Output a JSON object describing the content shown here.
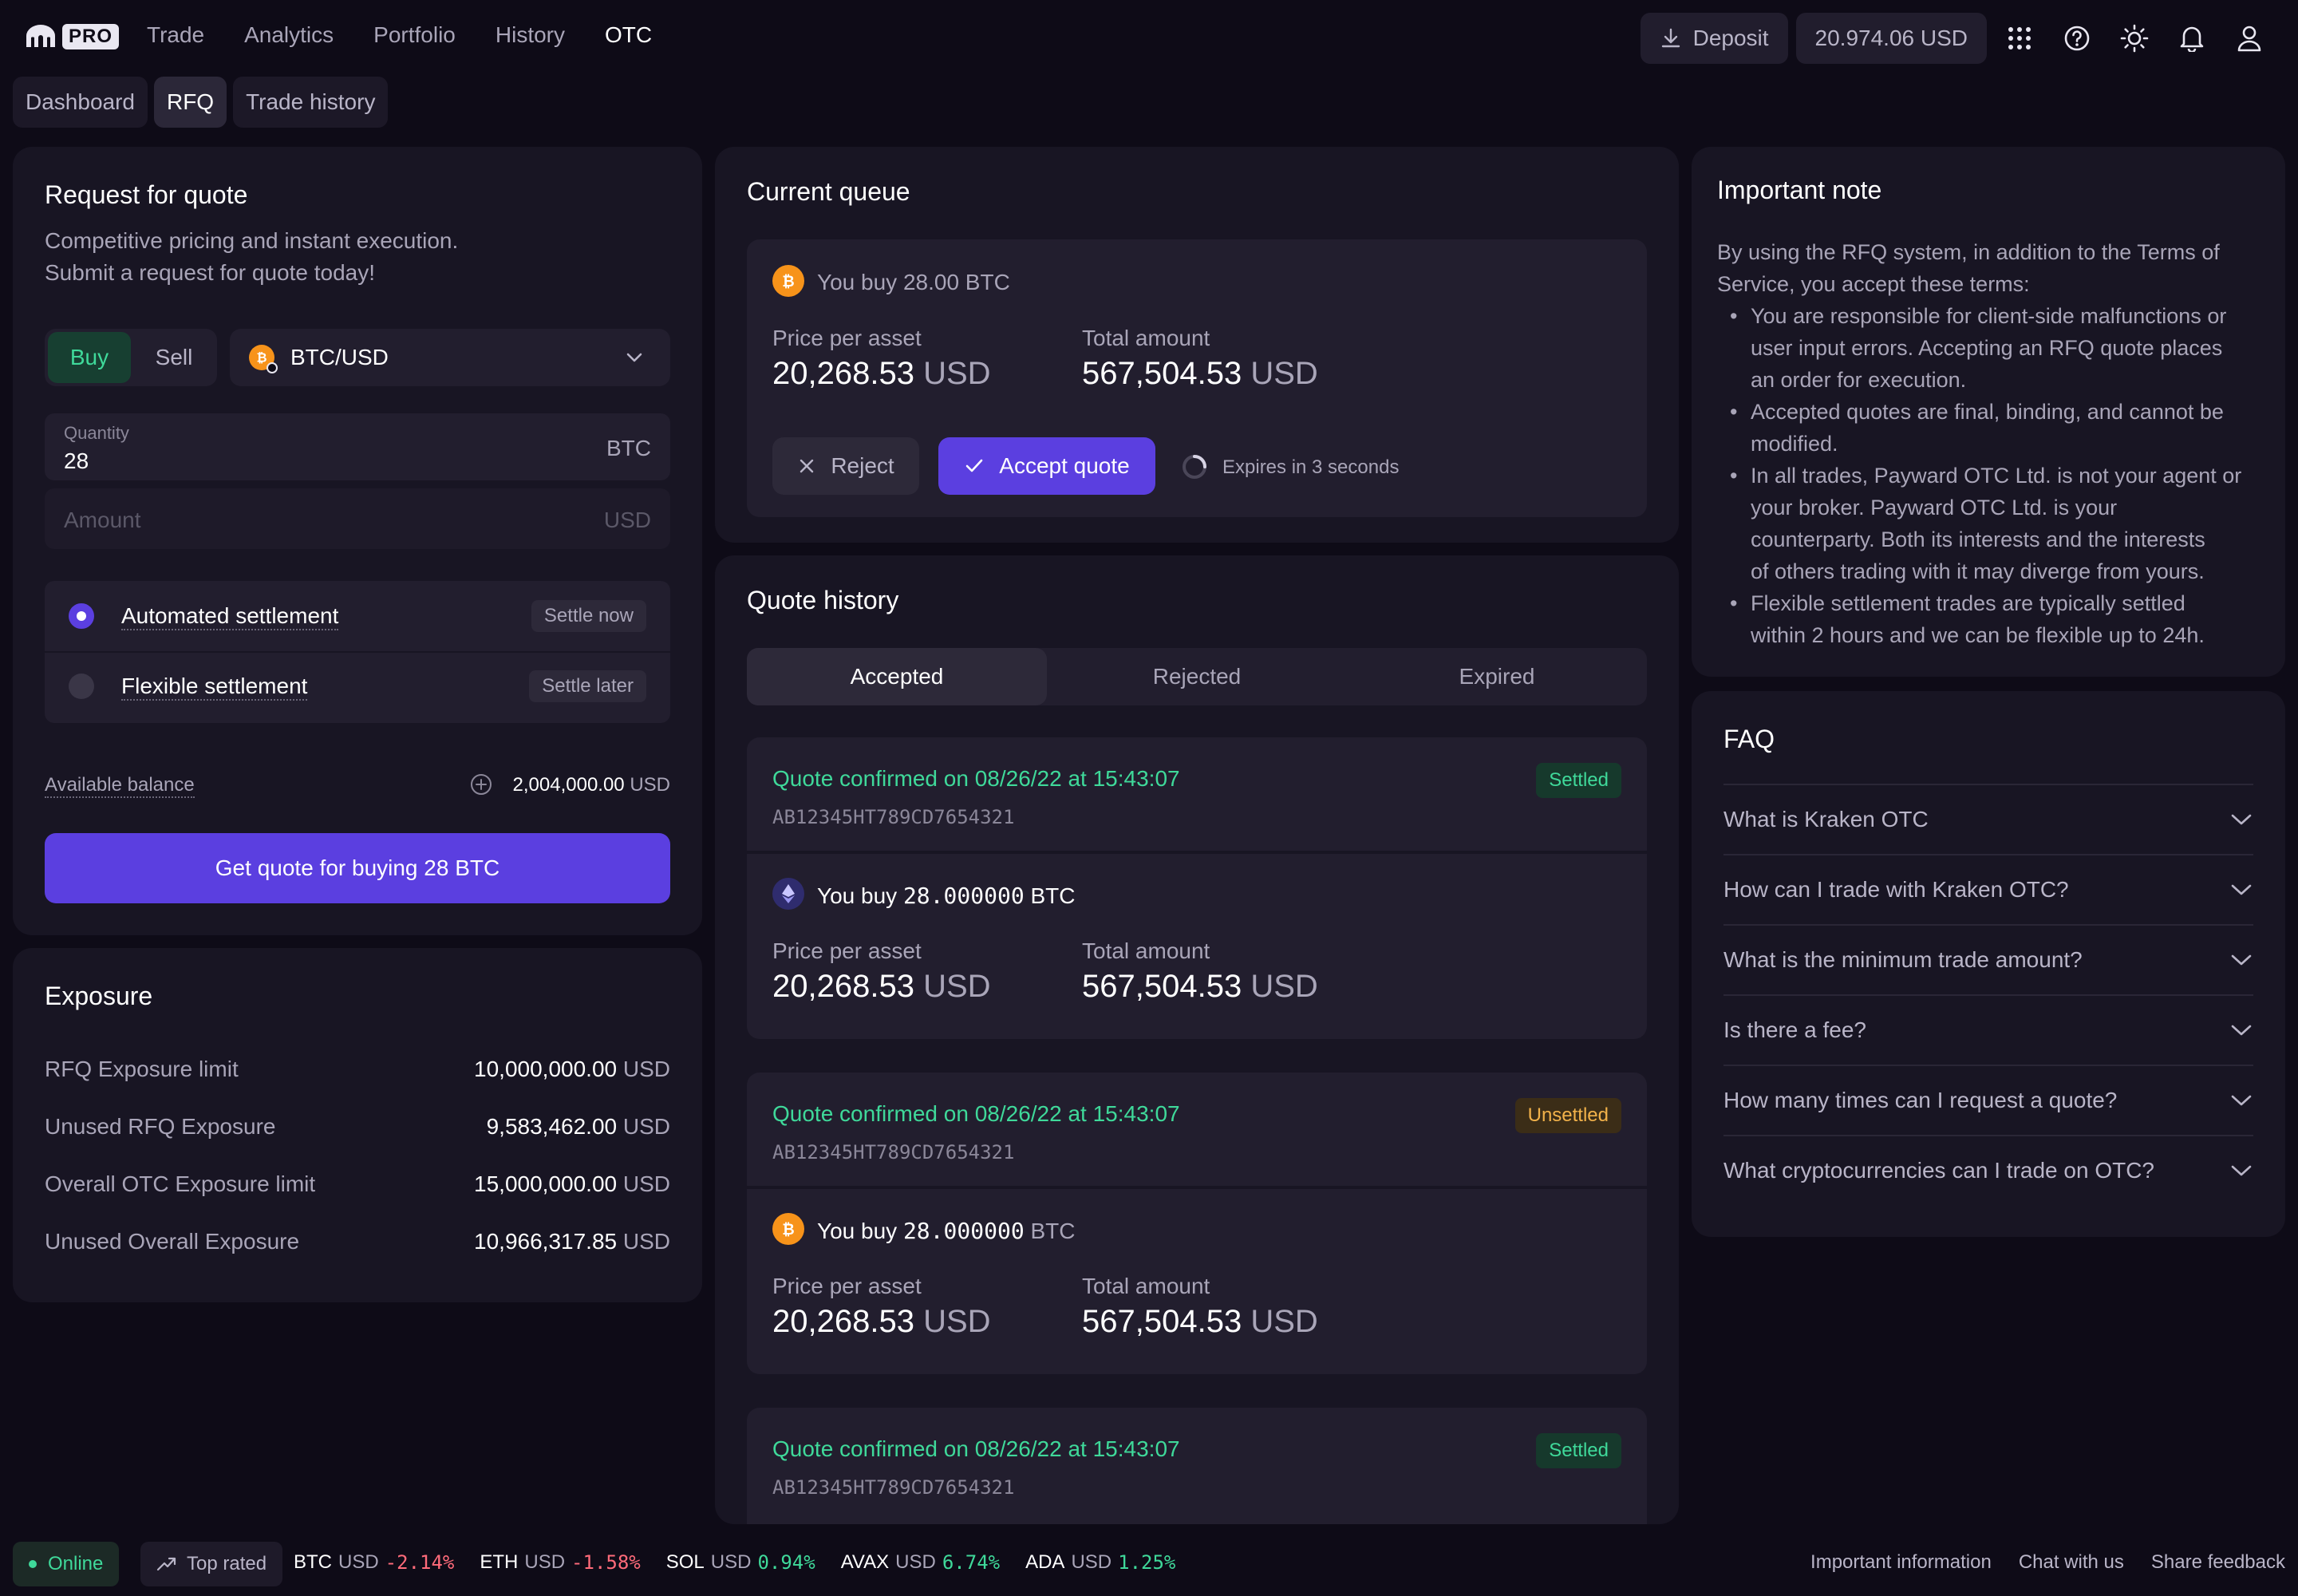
{
  "header": {
    "logo_badge": "PRO",
    "nav": [
      "Trade",
      "Analytics",
      "Portfolio",
      "History",
      "OTC"
    ],
    "deposit_label": "Deposit",
    "balance": "20.974.06 USD"
  },
  "subtabs": [
    "Dashboard",
    "RFQ",
    "Trade history"
  ],
  "rfq": {
    "title": "Request for quote",
    "desc_line1": "Competitive pricing and instant execution.",
    "desc_line2": "Submit a request for quote today!",
    "buy_label": "Buy",
    "sell_label": "Sell",
    "pair": "BTC/USD",
    "quantity_label": "Quantity",
    "quantity_value": "28",
    "quantity_unit": "BTC",
    "amount_placeholder": "Amount",
    "amount_unit": "USD",
    "auto_label": "Automated settlement",
    "auto_tag": "Settle now",
    "flex_label": "Flexible settlement",
    "flex_tag": "Settle later",
    "balance_label": "Available balance",
    "balance_value": "2,004,000.00",
    "balance_unit": "USD",
    "cta": "Get quote for buying 28 BTC"
  },
  "exposure": {
    "title": "Exposure",
    "rows": [
      {
        "label": "RFQ Exposure limit",
        "value": "10,000,000.00",
        "unit": "USD"
      },
      {
        "label": "Unused RFQ Exposure",
        "value": "9,583,462.00",
        "unit": "USD"
      },
      {
        "label": "Overall OTC Exposure limit",
        "value": "15,000,000.00",
        "unit": "USD"
      },
      {
        "label": "Unused Overall Exposure",
        "value": "10,966,317.85",
        "unit": "USD"
      }
    ]
  },
  "queue": {
    "title": "Current queue",
    "you_buy": "You buy 28.00 BTC",
    "price_label": "Price per asset",
    "price_value": "20,268.53",
    "price_unit": "USD",
    "total_label": "Total amount",
    "total_value": "567,504.53",
    "total_unit": "USD",
    "reject": "Reject",
    "accept": "Accept quote",
    "expires": "Expires in 3 seconds"
  },
  "history": {
    "title": "Quote history",
    "tabs": [
      "Accepted",
      "Rejected",
      "Expired"
    ],
    "items": [
      {
        "confirmed": "Quote confirmed on 08/26/22 at 15:43:07",
        "id": "AB12345HT789CD7654321",
        "status": "Settled",
        "buy_prefix": "You buy ",
        "buy_amount": "28.000000",
        "buy_asset": "BTC",
        "price_label": "Price per asset",
        "price_value": "20,268.53",
        "price_unit": "USD",
        "total_label": "Total amount",
        "total_value": "567,504.53",
        "total_unit": "USD"
      },
      {
        "confirmed": "Quote confirmed on 08/26/22 at 15:43:07",
        "id": "AB12345HT789CD7654321",
        "status": "Unsettled",
        "buy_prefix": "You buy ",
        "buy_amount": "28.000000",
        "buy_asset": "BTC",
        "price_label": "Price per asset",
        "price_value": "20,268.53",
        "price_unit": "USD",
        "total_label": "Total amount",
        "total_value": "567,504.53",
        "total_unit": "USD"
      },
      {
        "confirmed": "Quote confirmed on 08/26/22 at 15:43:07",
        "id": "AB12345HT789CD7654321",
        "status": "Settled"
      }
    ]
  },
  "note": {
    "title": "Important note",
    "intro_1": "By using the RFQ system, in addition to the Terms of",
    "intro_2": "Service, you accept these terms:",
    "bullets": [
      [
        "You are responsible for client-side malfunctions or",
        "user input errors. Accepting an RFQ quote places",
        "an order for execution."
      ],
      [
        "Accepted quotes are final, binding, and cannot be",
        "modified."
      ],
      [
        "In all trades, Payward OTC Ltd. is not your agent or",
        "your broker. Payward OTC Ltd. is your",
        "counterparty. Both its interests and the interests",
        "of others trading with it may diverge from yours."
      ],
      [
        "Flexible settlement trades are typically settled",
        "within 2 hours and we can be flexible up to 24h."
      ]
    ]
  },
  "faq": {
    "title": "FAQ",
    "items": [
      "What is Kraken OTC",
      "How can I trade with Kraken OTC?",
      "What is the minimum trade amount?",
      "Is there a fee?",
      "How many times can I request a quote?",
      "What cryptocurrencies can I trade on OTC?"
    ]
  },
  "footer": {
    "status": "Online",
    "top_rated": "Top rated",
    "tickers": [
      {
        "asset": "BTC",
        "quote": "USD",
        "change": "-2.14%"
      },
      {
        "asset": "ETH",
        "quote": "USD",
        "change": "-1.58%"
      },
      {
        "asset": "SOL",
        "quote": "USD",
        "change": "0.94%"
      },
      {
        "asset": "AVAX",
        "quote": "USD",
        "change": "6.74%"
      },
      {
        "asset": "ADA",
        "quote": "USD",
        "change": "1.25%"
      }
    ],
    "links": [
      "Important information",
      "Chat with us",
      "Share feedback"
    ]
  },
  "colors": {
    "accent": "#5b3fe0",
    "positive": "#3fd99a",
    "negative": "#ff6b7a",
    "warning": "#f2b24a",
    "background": "#0e0b17",
    "panel": "#181523"
  }
}
